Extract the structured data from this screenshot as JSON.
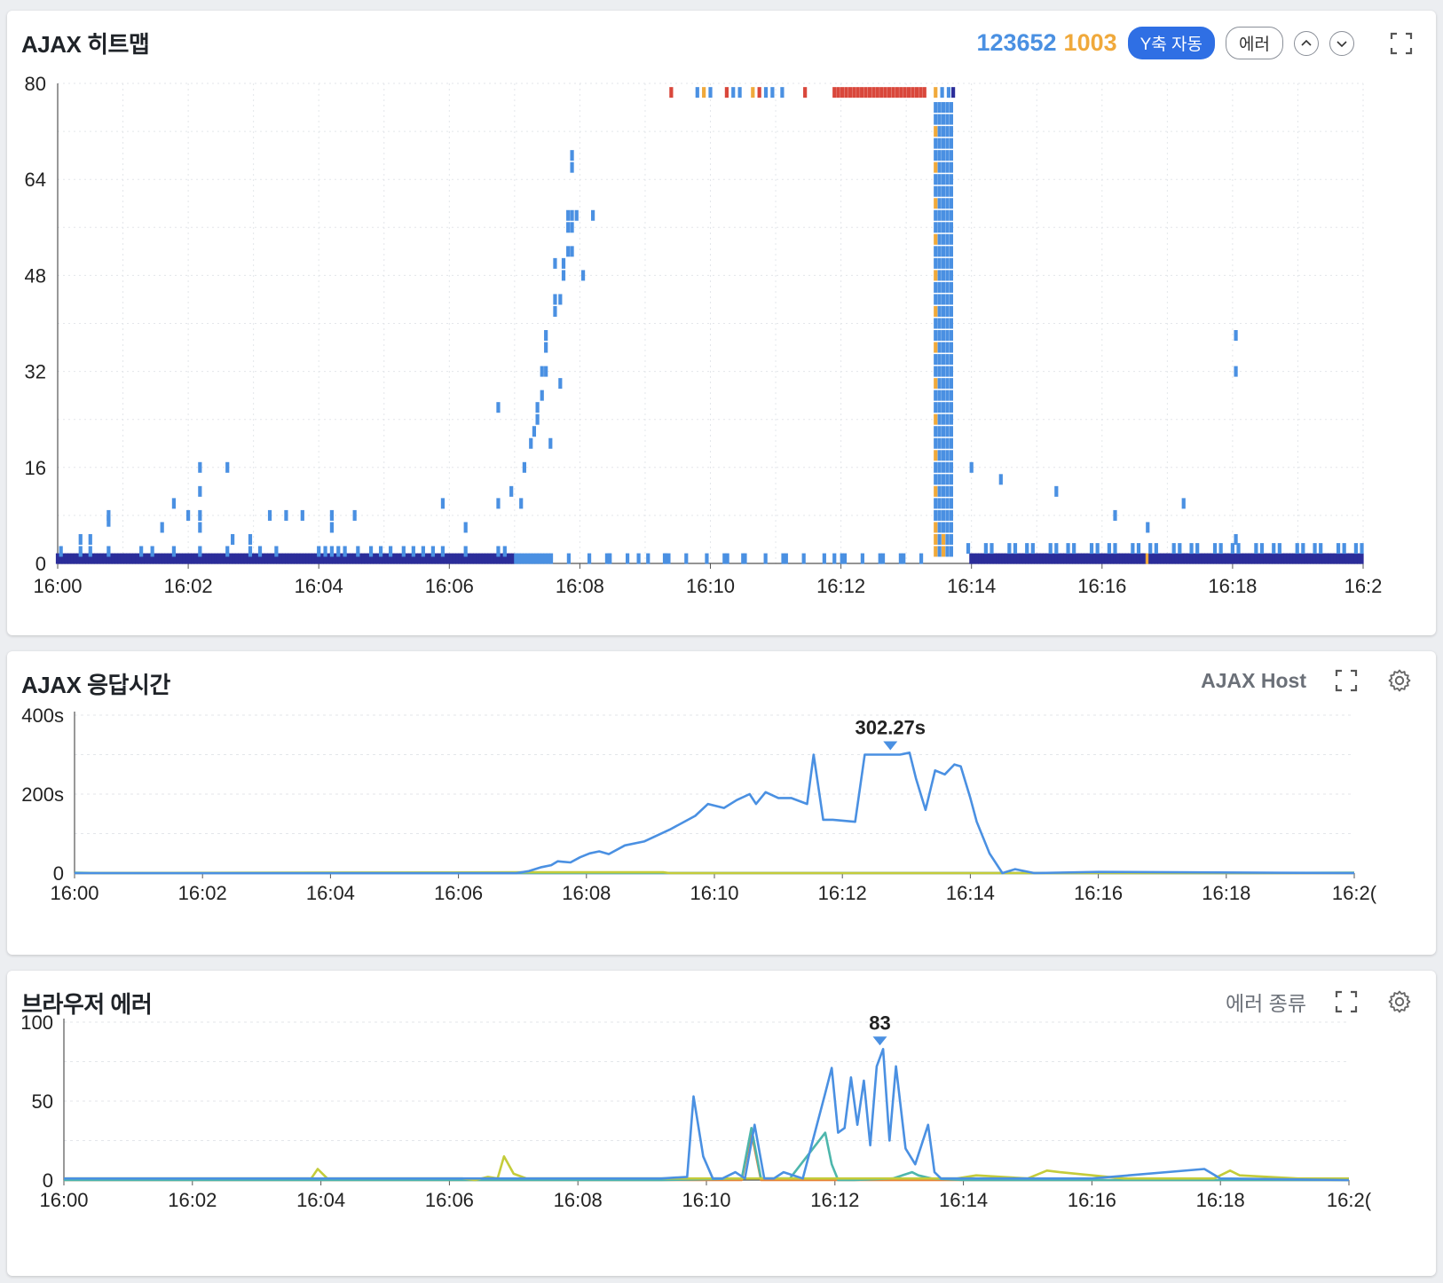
{
  "heatmap": {
    "title": "AJAX 히트맵",
    "total_count": "123652",
    "error_count": "1003",
    "y_axis_button": "Y축 자동",
    "error_button": "에러",
    "colors": {
      "normal": "#4a90e2",
      "slow": "#f0a93b",
      "error": "#d9473b",
      "dense": "#2b2d9a"
    }
  },
  "response": {
    "title": "AJAX 응답시간",
    "group_label": "AJAX Host",
    "peak_label": "302.27s"
  },
  "errors": {
    "title": "브라우저 에러",
    "group_label": "에러 종류",
    "peak_label": "83"
  },
  "chart_data": [
    {
      "type": "heatmap",
      "title": "AJAX 히트맵",
      "x_ticks": [
        "16:00",
        "16:02",
        "16:04",
        "16:06",
        "16:08",
        "16:10",
        "16:12",
        "16:14",
        "16:16",
        "16:18",
        "16:2"
      ],
      "y_ticks": [
        "0",
        "16",
        "32",
        "48",
        "64",
        "80"
      ],
      "x_range_min": [
        0,
        20
      ],
      "y_range": [
        0,
        80
      ],
      "grid": true,
      "cell_legend": {
        "blue": "normal",
        "orange": "slow",
        "red": "error",
        "navy": "dense"
      },
      "points": [
        {
          "t": 0.05,
          "y": 2
        },
        {
          "t": 0.35,
          "y": 2
        },
        {
          "t": 0.35,
          "y": 4
        },
        {
          "t": 0.5,
          "y": 2
        },
        {
          "t": 0.5,
          "y": 4
        },
        {
          "t": 0.78,
          "y": 2
        },
        {
          "t": 0.78,
          "y": 8
        },
        {
          "t": 0.78,
          "y": 7
        },
        {
          "t": 1.28,
          "y": 2
        },
        {
          "t": 1.45,
          "y": 2
        },
        {
          "t": 1.6,
          "y": 6
        },
        {
          "t": 1.78,
          "y": 2
        },
        {
          "t": 1.78,
          "y": 10
        },
        {
          "t": 2.0,
          "y": 8
        },
        {
          "t": 2.18,
          "y": 2
        },
        {
          "t": 2.18,
          "y": 6
        },
        {
          "t": 2.18,
          "y": 8
        },
        {
          "t": 2.18,
          "y": 12
        },
        {
          "t": 2.18,
          "y": 16
        },
        {
          "t": 2.6,
          "y": 2
        },
        {
          "t": 2.6,
          "y": 16
        },
        {
          "t": 2.68,
          "y": 4
        },
        {
          "t": 2.95,
          "y": 2
        },
        {
          "t": 2.95,
          "y": 4
        },
        {
          "t": 3.1,
          "y": 2
        },
        {
          "t": 3.25,
          "y": 8
        },
        {
          "t": 3.35,
          "y": 2
        },
        {
          "t": 3.5,
          "y": 8
        },
        {
          "t": 3.75,
          "y": 8
        },
        {
          "t": 4.0,
          "y": 2
        },
        {
          "t": 4.1,
          "y": 2
        },
        {
          "t": 4.2,
          "y": 2
        },
        {
          "t": 4.2,
          "y": 6
        },
        {
          "t": 4.2,
          "y": 8
        },
        {
          "t": 4.3,
          "y": 2
        },
        {
          "t": 4.4,
          "y": 2
        },
        {
          "t": 4.55,
          "y": 8
        },
        {
          "t": 4.6,
          "y": 2
        },
        {
          "t": 4.8,
          "y": 2
        },
        {
          "t": 4.95,
          "y": 2
        },
        {
          "t": 5.1,
          "y": 2
        },
        {
          "t": 5.3,
          "y": 2
        },
        {
          "t": 5.45,
          "y": 2
        },
        {
          "t": 5.6,
          "y": 2
        },
        {
          "t": 5.75,
          "y": 2
        },
        {
          "t": 5.9,
          "y": 2
        },
        {
          "t": 5.9,
          "y": 10
        },
        {
          "t": 6.25,
          "y": 2
        },
        {
          "t": 6.25,
          "y": 6
        },
        {
          "t": 6.75,
          "y": 2
        },
        {
          "t": 6.75,
          "y": 10
        },
        {
          "t": 6.75,
          "y": 26
        },
        {
          "t": 6.85,
          "y": 2
        },
        {
          "t": 6.95,
          "y": 12
        },
        {
          "t": 7.1,
          "y": 10
        },
        {
          "t": 7.15,
          "y": 16
        },
        {
          "t": 7.25,
          "y": 20
        },
        {
          "t": 7.3,
          "y": 22
        },
        {
          "t": 7.35,
          "y": 24
        },
        {
          "t": 7.35,
          "y": 26
        },
        {
          "t": 7.42,
          "y": 28
        },
        {
          "t": 7.42,
          "y": 32
        },
        {
          "t": 7.48,
          "y": 32
        },
        {
          "t": 7.48,
          "y": 36
        },
        {
          "t": 7.48,
          "y": 38
        },
        {
          "t": 7.55,
          "y": 20
        },
        {
          "t": 7.62,
          "y": 42
        },
        {
          "t": 7.62,
          "y": 44
        },
        {
          "t": 7.7,
          "y": 44
        },
        {
          "t": 7.62,
          "y": 50
        },
        {
          "t": 7.7,
          "y": 30
        },
        {
          "t": 7.75,
          "y": 48
        },
        {
          "t": 7.75,
          "y": 50
        },
        {
          "t": 7.82,
          "y": 52
        },
        {
          "t": 7.82,
          "y": 56
        },
        {
          "t": 7.82,
          "y": 58
        },
        {
          "t": 7.88,
          "y": 52
        },
        {
          "t": 7.88,
          "y": 56
        },
        {
          "t": 7.88,
          "y": 58
        },
        {
          "t": 7.88,
          "y": 66
        },
        {
          "t": 7.88,
          "y": 68
        },
        {
          "t": 7.95,
          "y": 58
        },
        {
          "t": 8.05,
          "y": 48
        },
        {
          "t": 8.2,
          "y": 58
        },
        {
          "t": 8.45,
          "y": 0.8
        },
        {
          "t": 8.9,
          "y": 0.8
        },
        {
          "t": 9.3,
          "y": 0.8
        },
        {
          "t": 10.5,
          "y": 0.8
        },
        {
          "t": 11.9,
          "y": 0.8
        },
        {
          "t": 12.6,
          "y": 0.8
        },
        {
          "t": 14.0,
          "y": 16
        },
        {
          "t": 14.45,
          "y": 14
        },
        {
          "t": 15.3,
          "y": 12
        },
        {
          "t": 16.2,
          "y": 8
        },
        {
          "t": 16.7,
          "y": 6
        },
        {
          "t": 17.25,
          "y": 10
        },
        {
          "t": 18.05,
          "y": 38
        },
        {
          "t": 18.05,
          "y": 32
        },
        {
          "t": 18.05,
          "y": 4
        }
      ]
    },
    {
      "type": "line",
      "title": "AJAX 응답시간",
      "x_ticks": [
        "16:00",
        "16:02",
        "16:04",
        "16:06",
        "16:08",
        "16:10",
        "16:12",
        "16:14",
        "16:16",
        "16:18",
        "16:2("
      ],
      "y_ticks": [
        "0",
        "200s",
        "400s"
      ],
      "ylim": [
        0,
        400
      ],
      "annotation": {
        "label": "302.27s",
        "x": 12.75,
        "y": 302.27
      },
      "series": [
        {
          "color": "#4a90e2",
          "x": [
            0,
            6.9,
            7.1,
            7.3,
            7.45,
            7.55,
            7.75,
            7.9,
            8.05,
            8.2,
            8.35,
            8.6,
            8.9,
            9.3,
            9.7,
            9.9,
            10.15,
            10.35,
            10.55,
            10.65,
            10.8,
            11.0,
            11.2,
            11.45,
            11.55,
            11.7,
            11.85,
            12.2,
            12.35,
            12.9,
            13.05,
            13.15,
            13.3,
            13.45,
            13.6,
            13.75,
            13.85,
            14.0,
            14.1,
            14.3,
            14.5,
            14.7,
            15.0,
            16.0,
            20.0
          ],
          "y": [
            0,
            0,
            5,
            15,
            20,
            30,
            27,
            40,
            50,
            55,
            48,
            70,
            80,
            110,
            145,
            175,
            165,
            185,
            200,
            175,
            205,
            190,
            190,
            175,
            300,
            135,
            135,
            130,
            300,
            300,
            305,
            240,
            160,
            260,
            250,
            275,
            270,
            190,
            130,
            50,
            0,
            10,
            0,
            3,
            0
          ]
        },
        {
          "color": "#c4cc3a",
          "x": [
            0,
            7.0,
            9.2,
            9.3,
            20.0
          ],
          "y": [
            0,
            2,
            2,
            0,
            0
          ]
        },
        {
          "color": "#4db6ac",
          "x": [
            0,
            0.5,
            18.0,
            20.0
          ],
          "y": [
            1,
            0,
            0,
            1
          ]
        },
        {
          "color": "#5b3ec8",
          "x": [
            0,
            20.0
          ],
          "y": [
            0,
            0
          ]
        }
      ]
    },
    {
      "type": "line",
      "title": "브라우저 에러",
      "x_ticks": [
        "16:00",
        "16:02",
        "16:04",
        "16:06",
        "16:08",
        "16:10",
        "16:12",
        "16:14",
        "16:16",
        "16:18",
        "16:2("
      ],
      "y_ticks": [
        "0",
        "50",
        "100"
      ],
      "ylim": [
        0,
        100
      ],
      "annotation": {
        "label": "83",
        "x": 12.7,
        "y": 83
      },
      "series": [
        {
          "color": "#4a90e2",
          "x": [
            0,
            2,
            7,
            9.3,
            9.7,
            9.8,
            9.95,
            10.1,
            10.25,
            10.45,
            10.6,
            10.75,
            10.9,
            11.05,
            11.2,
            11.5,
            11.85,
            11.95,
            12.05,
            12.15,
            12.25,
            12.35,
            12.45,
            12.55,
            12.65,
            12.75,
            12.85,
            12.95,
            13.1,
            13.25,
            13.45,
            13.55,
            13.65,
            13.75,
            16.0,
            17.75,
            18.0,
            20.0
          ],
          "y": [
            1,
            1,
            1,
            1,
            2,
            53,
            15,
            1,
            1,
            5,
            1,
            35,
            1,
            1,
            5,
            1,
            55,
            71,
            30,
            33,
            65,
            35,
            63,
            22,
            72,
            83,
            25,
            72,
            20,
            10,
            35,
            5,
            1,
            1,
            1,
            7,
            1,
            0
          ],
          "peak_index": 25
        },
        {
          "color": "#c4cc3a",
          "x": [
            0,
            3.85,
            3.95,
            4.1,
            5.4,
            6.2,
            6.4,
            6.6,
            6.75,
            6.85,
            7.0,
            7.2,
            8.0,
            9.5,
            10.2,
            12.5,
            13.9,
            14.2,
            15.0,
            15.3,
            15.5,
            16.5,
            17.9,
            18.15,
            18.3,
            19.2,
            20.0
          ],
          "y": [
            1,
            1,
            7,
            1,
            1,
            1,
            0,
            2,
            1,
            15,
            4,
            1,
            1,
            1,
            1,
            1,
            1,
            3,
            1,
            6,
            5,
            1,
            1,
            6,
            3,
            1,
            1
          ]
        },
        {
          "color": "#4db6ac",
          "x": [
            0,
            9.3,
            10.55,
            10.7,
            10.85,
            11.3,
            11.85,
            11.95,
            12.05,
            12.3,
            12.9,
            13.2,
            13.3,
            13.5,
            14.0,
            20.0
          ],
          "y": [
            0,
            0,
            1,
            33,
            1,
            1,
            30,
            10,
            0,
            0,
            1,
            5,
            3,
            1,
            0,
            0
          ]
        },
        {
          "color": "#e8833a",
          "x": [
            0,
            10.55,
            10.7,
            10.85,
            20.0
          ],
          "y": [
            0,
            0,
            30,
            0,
            0
          ]
        }
      ]
    }
  ]
}
